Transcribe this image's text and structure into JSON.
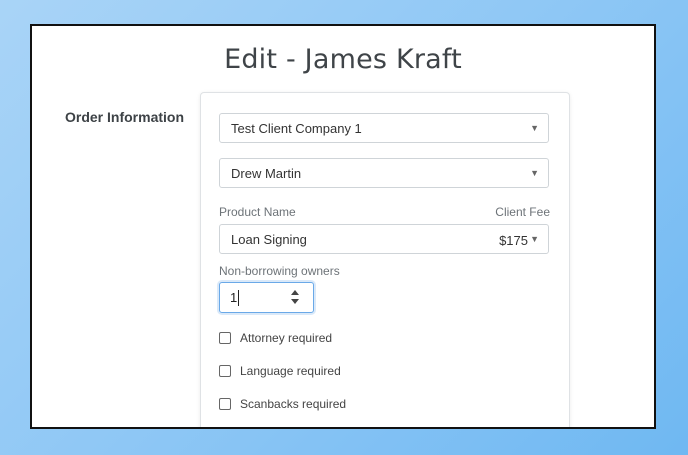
{
  "page": {
    "title": "Edit - James Kraft",
    "section_label": "Order Information"
  },
  "form": {
    "client_company": {
      "value": "Test Client Company 1",
      "icon": "chevron-down-icon"
    },
    "contact": {
      "value": "Drew Martin",
      "icon": "chevron-down-icon"
    },
    "product_name_label": "Product Name",
    "client_fee_label": "Client Fee",
    "product": {
      "value": "Loan Signing",
      "fee": "$175",
      "icon": "chevron-down-icon"
    },
    "non_borrowing_owners_label": "Non-borrowing owners",
    "non_borrowing_owners_value": "1",
    "checkboxes": [
      {
        "label": "Attorney required",
        "checked": false
      },
      {
        "label": "Language required",
        "checked": false
      },
      {
        "label": "Scanbacks required",
        "checked": false
      }
    ]
  },
  "colors": {
    "background_gradient_start": "#a9d4f7",
    "background_gradient_end": "#6fb8f2",
    "focus_border": "#6aa9e8",
    "text_dark": "#3f4448"
  }
}
